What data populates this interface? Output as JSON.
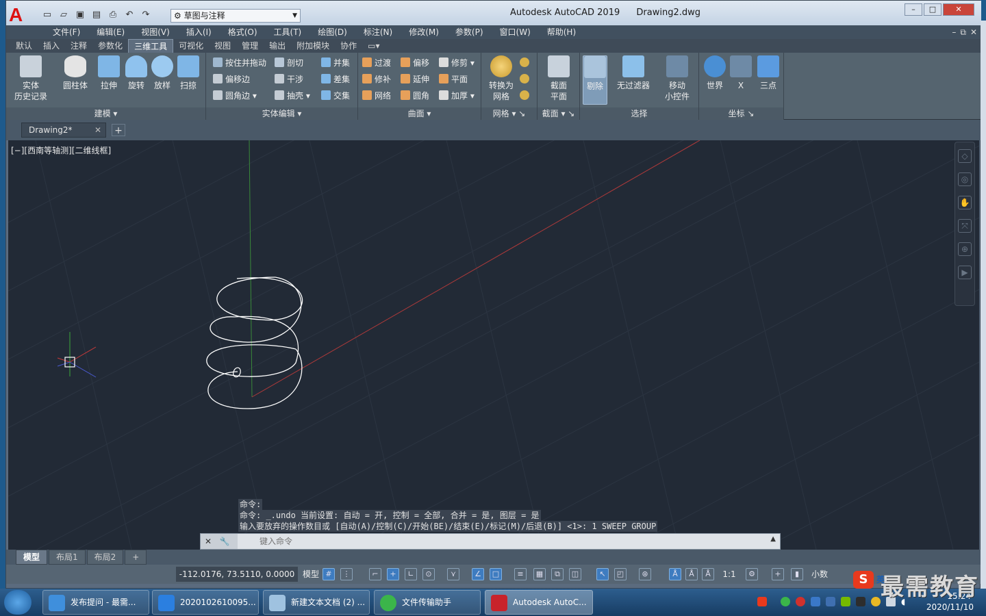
{
  "app": {
    "title": "Autodesk AutoCAD 2019",
    "file": "Drawing2.dwg",
    "logo": "A",
    "workspace": "草图与注释"
  },
  "menubar": [
    "文件(F)",
    "编辑(E)",
    "视图(V)",
    "插入(I)",
    "格式(O)",
    "工具(T)",
    "绘图(D)",
    "标注(N)",
    "修改(M)",
    "参数(P)",
    "窗口(W)",
    "帮助(H)"
  ],
  "ribbon_tabs": [
    "默认",
    "插入",
    "注释",
    "参数化",
    "三维工具",
    "可视化",
    "视图",
    "管理",
    "输出",
    "附加模块",
    "协作"
  ],
  "ribbon_active": "三维工具",
  "panels": {
    "modeling": {
      "title": "建模",
      "buttons": [
        "实体\n历史记录",
        "圆柱体",
        "拉伸",
        "旋转",
        "放样",
        "扫掠"
      ]
    },
    "solid_edit": {
      "title": "实体编辑",
      "items": [
        "按住并拖动",
        "剖切",
        "并集",
        "偏移边",
        "干涉",
        "差集",
        "圆角边",
        "抽壳",
        "交集"
      ]
    },
    "surface": {
      "title": "曲面",
      "items": [
        "过渡",
        "偏移",
        "修剪",
        "修补",
        "延伸",
        "平面",
        "网络",
        "圆角",
        "加厚"
      ]
    },
    "mesh": {
      "title": "网格",
      "button": "转换为\n网格"
    },
    "section": {
      "title": "截面",
      "button": "截面\n平面"
    },
    "selection": {
      "title": "选择",
      "buttons": [
        "剔除",
        "无过滤器",
        "移动\n小控件"
      ]
    },
    "coordinates": {
      "title": "坐标",
      "buttons": [
        "世界",
        "X",
        "三点"
      ]
    }
  },
  "doc_tab": "Drawing2*",
  "viewport_label": "[−][西南等轴测][二维线框]",
  "command_history": [
    "命令:",
    "命令: _.undo 当前设置: 自动 = 开, 控制 = 全部, 合并 = 是, 图层 = 是",
    "输入要放弃的操作数目或 [自动(A)/控制(C)/开始(BE)/结束(E)/标记(M)/后退(B)] <1>: 1 SWEEP GROUP"
  ],
  "command_placeholder": "键入命令",
  "layout_tabs": [
    "模型",
    "布局1",
    "布局2"
  ],
  "status": {
    "coords": "-112.0176, 73.5110, 0.0000",
    "model_label": "模型",
    "scale": "1:1",
    "units": "小数"
  },
  "taskbar": {
    "items": [
      "发布提问 - 最需...",
      "2020102610095...",
      "新建文本文档 (2) ...",
      "文件传输助手",
      "Autodesk AutoC..."
    ],
    "date": "2020/11/10",
    "time": "15:24",
    "ime": "英"
  },
  "watermark": "最需教育",
  "colors": {
    "viewport_bg": "#222a36",
    "helix": "#ffffff",
    "x_axis": "#b03a3a",
    "y_axis": "#3a8a3a",
    "grid": "#2c3542"
  }
}
